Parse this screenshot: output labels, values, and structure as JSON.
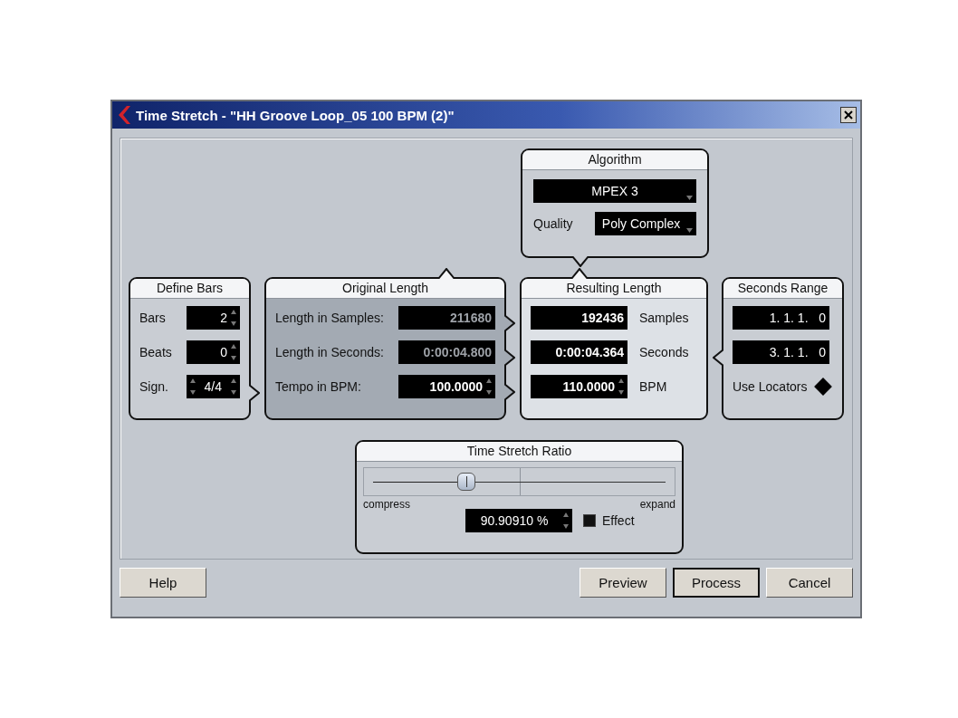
{
  "window": {
    "title": "Time Stretch - \"HH Groove Loop_05 100 BPM (2)\""
  },
  "algorithm": {
    "title": "Algorithm",
    "mode": "MPEX 3",
    "quality_label": "Quality",
    "quality": "Poly Complex"
  },
  "define_bars": {
    "title": "Define Bars",
    "rows": [
      {
        "label": "Bars",
        "value": "2",
        "kind": "number"
      },
      {
        "label": "Beats",
        "value": "0",
        "kind": "number"
      },
      {
        "label": "Sign.",
        "value": "4/4",
        "kind": "signature"
      }
    ]
  },
  "original_length": {
    "title": "Original Length",
    "rows": [
      {
        "label": "Length in Samples:",
        "value": "211680",
        "disabled": true
      },
      {
        "label": "Length in Seconds:",
        "value": "0:00:04.800",
        "disabled": true
      },
      {
        "label": "Tempo in BPM:",
        "value": "100.0000",
        "disabled": false
      }
    ]
  },
  "resulting_length": {
    "title": "Resulting Length",
    "rows": [
      {
        "value": "192436",
        "label": "Samples",
        "spinner": false
      },
      {
        "value": "0:00:04.364",
        "label": "Seconds",
        "spinner": false
      },
      {
        "value": "110.0000",
        "label": "BPM",
        "spinner": true
      }
    ]
  },
  "seconds_range": {
    "title": "Seconds Range",
    "values": [
      "1. 1. 1.   0",
      "3. 1. 1.   0"
    ],
    "locators_label": "Use Locators"
  },
  "time_stretch_ratio": {
    "title": "Time Stretch Ratio",
    "slider": {
      "level": 0.32
    },
    "min_label": "compress",
    "max_label": "expand",
    "value": "90.90910 %",
    "effect_label": "Effect",
    "effect_checked": true
  },
  "left_buttons": [
    {
      "label": "Help",
      "default": false
    }
  ],
  "right_buttons": [
    {
      "label": "Preview",
      "default": false
    },
    {
      "label": "Process",
      "default": true
    },
    {
      "label": "Cancel",
      "default": false
    }
  ]
}
